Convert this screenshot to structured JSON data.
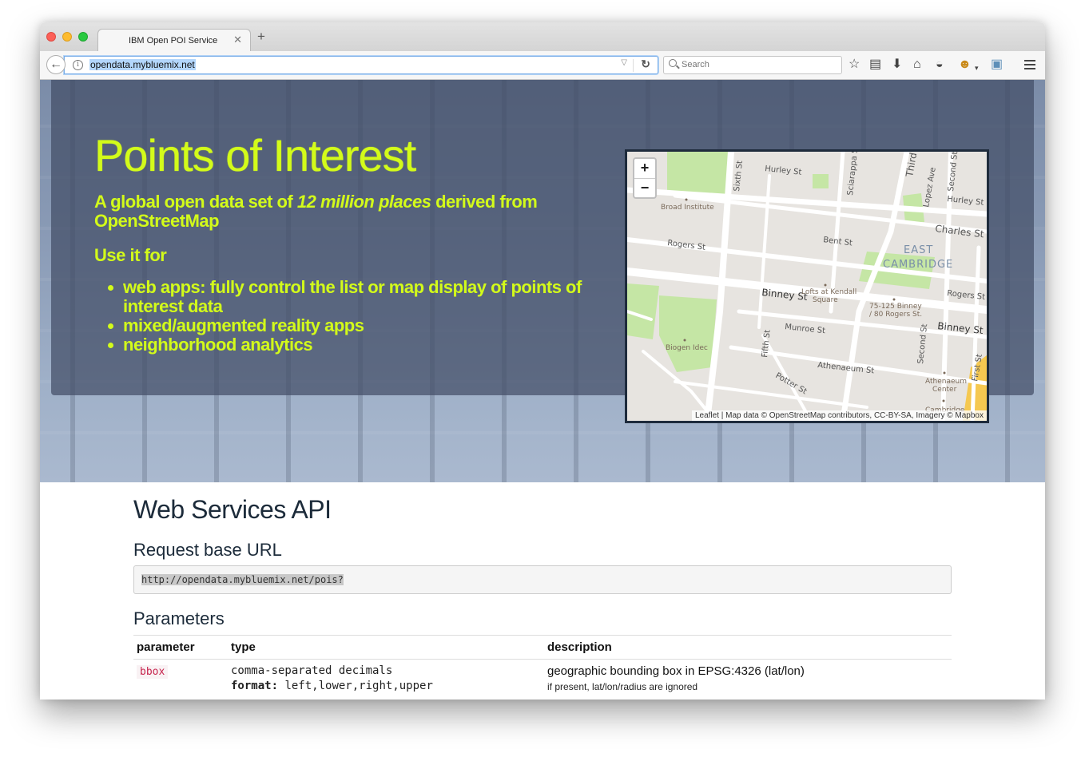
{
  "browser": {
    "tab_title": "IBM Open POI Service",
    "url": "opendata.mybluemix.net",
    "search_placeholder": "Search"
  },
  "hero": {
    "title": "Points of Interest",
    "subtitle_before": "A global open data set of ",
    "subtitle_em": "12 million places",
    "subtitle_after": " derived from OpenStreetMap",
    "use_for": "Use it for",
    "uses": [
      "web apps: fully control the list or map display of points of interest data",
      "mixed/augmented reality apps",
      "neighborhood analytics"
    ]
  },
  "map": {
    "zoom_in": "+",
    "zoom_out": "−",
    "attribution": "Leaflet | Map data © OpenStreetMap contributors, CC-BY-SA, Imagery © Mapbox",
    "labels": {
      "hurley_st": "Hurley St",
      "hurley_st_2": "Hurley St",
      "sixth_st": "Sixth St",
      "sciarappa_st": "Sciarappa St",
      "third_st": "Third St",
      "lopez_ave": "Lopez Ave",
      "second_st": "Second St",
      "broad_institute": "Broad Institute",
      "charles_st": "Charles St",
      "rogers_st": "Rogers St",
      "bent_st": "Bent St",
      "east": "EAST",
      "cambridge": "CAMBRIDGE",
      "binney_st": "Binney St",
      "lofts_1": "Lofts at Kendall",
      "lofts_2": "Square",
      "rogers_st_2": "Rogers St",
      "binney_addr_1": "75-125 Binney",
      "binney_addr_2": "/ 80 Rogers St.",
      "munroe_st": "Munroe St",
      "binney_st_2": "Binney St",
      "biogen": "Biogen Idec",
      "fifth_st": "Fifth St",
      "second_st_2": "Second St",
      "athenaeum_st": "Athenaeum St",
      "first_st": "First St",
      "potter_st": "Potter St",
      "athenaeum_center_1": "Athenaeum",
      "athenaeum_center_2": "Center",
      "cambridge_2": "Cambridge"
    }
  },
  "api": {
    "heading": "Web Services API",
    "request_heading": "Request base URL",
    "base_url": "http://opendata.mybluemix.net/pois?",
    "params_heading": "Parameters",
    "columns": [
      "parameter",
      "type",
      "description"
    ],
    "rows": [
      {
        "parameter": "bbox",
        "type": "comma-separated decimals",
        "format_label": "format:",
        "format_value": " left,lower,right,upper",
        "description": "geographic bounding box in EPSG:4326 (lat/lon)",
        "note": "if present, lat/lon/radius are ignored"
      }
    ]
  },
  "colors": {
    "hero_text": "#d3fb1a",
    "heading": "#1c2b3a",
    "code_red": "#c7254e"
  }
}
